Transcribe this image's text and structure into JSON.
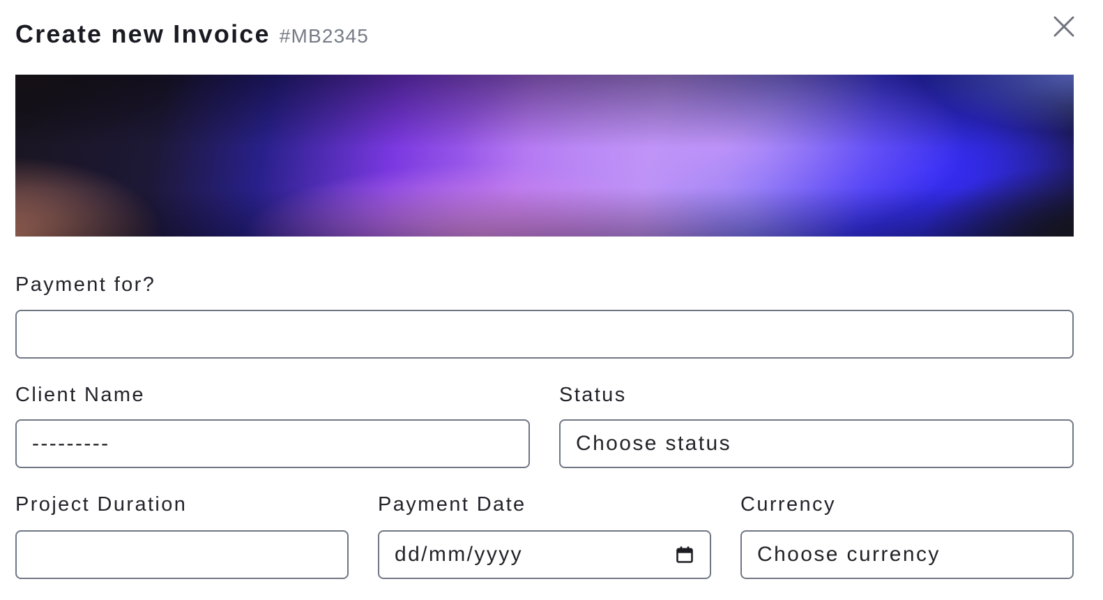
{
  "header": {
    "title": "Create new Invoice",
    "invoice_id": "#MB2345"
  },
  "icons": {
    "close": "close-icon",
    "calendar": "calendar-icon"
  },
  "banner": {
    "colors": [
      "#1a1520",
      "#7a38e0",
      "#b890f6",
      "#3633f0",
      "#16152a"
    ]
  },
  "form": {
    "payment_for": {
      "label": "Payment for?",
      "value": ""
    },
    "client_name": {
      "label": "Client Name",
      "value": "---------"
    },
    "status": {
      "label": "Status",
      "value": "Choose status"
    },
    "project_duration": {
      "label": "Project Duration",
      "value": ""
    },
    "payment_date": {
      "label": "Payment Date",
      "value": "dd/mm/yyyy"
    },
    "currency": {
      "label": "Currency",
      "value": "Choose currency"
    }
  },
  "colors": {
    "border": "#6f7683",
    "text": "#22222a",
    "muted": "#767b86"
  }
}
